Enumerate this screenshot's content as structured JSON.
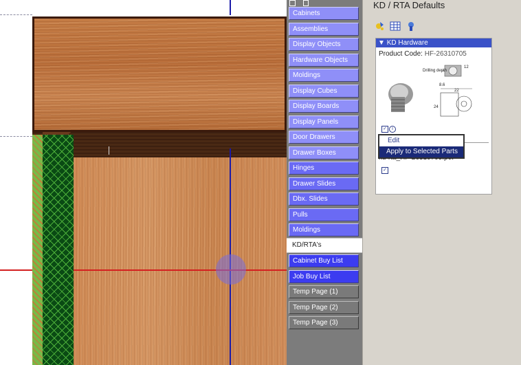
{
  "palette": {
    "buttons": [
      {
        "label": "Cabinets",
        "style": "light"
      },
      {
        "label": "Assemblies",
        "style": "light"
      },
      {
        "label": "Display Objects",
        "style": "light"
      },
      {
        "label": "Hardware Objects",
        "style": "light"
      },
      {
        "label": "Moldings",
        "style": "light"
      },
      {
        "label": "Display Cubes",
        "style": "light"
      },
      {
        "label": "Display Boards",
        "style": "light"
      },
      {
        "label": "Display Panels",
        "style": "light"
      },
      {
        "label": "Door Drawers",
        "style": "light"
      },
      {
        "label": "Drawer Boxes",
        "style": "light"
      },
      {
        "label": "Hinges",
        "style": "mid"
      },
      {
        "label": "Drawer Slides",
        "style": "mid"
      },
      {
        "label": "Dbx. Slides",
        "style": "mid"
      },
      {
        "label": "Pulls",
        "style": "mid"
      },
      {
        "label": "Moldings",
        "style": "mid"
      }
    ],
    "active_tab": "KD/RTA's",
    "lower_buttons": [
      {
        "label": "Cabinet Buy List",
        "style": "deep"
      },
      {
        "label": "Job Buy List",
        "style": "deep"
      },
      {
        "label": "Temp Page (1)",
        "style": "gray"
      },
      {
        "label": "Temp Page (2)",
        "style": "gray"
      },
      {
        "label": "Temp Page (3)",
        "style": "gray"
      }
    ]
  },
  "properties": {
    "title": "KD / RTA Defaults",
    "toolbar_icons": [
      "wizard-icon",
      "grid-icon",
      "hardware-icon"
    ],
    "card": {
      "header": "KD Hardware",
      "product_code_label": "Product Code:",
      "product_code_value": "HF-26310705",
      "file_label": "kd-rta_HF-26310705.pct",
      "diagram": {
        "drilling_label": "Drilling depth",
        "dims": [
          "12",
          "8.6",
          "22",
          "24"
        ]
      }
    },
    "context_menu": {
      "items": [
        "Edit",
        "Apply to Selected Parts"
      ],
      "selected_index": 1
    }
  },
  "colors": {
    "palette_light": "#8f8ff8",
    "palette_mid": "#6a6af4",
    "palette_deep": "#3c3cf0",
    "card_header": "#3a52c8",
    "guide_blue": "#1a1aa8",
    "guide_red": "#d42020"
  }
}
